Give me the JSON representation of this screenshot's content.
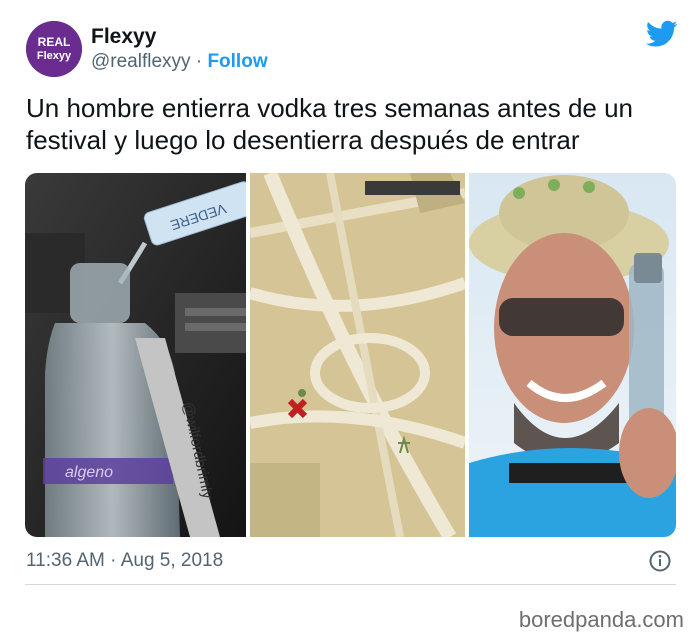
{
  "tweet": {
    "avatar_text_top": "REAL",
    "avatar_text_bottom": "Flexyy",
    "display_name": "Flexyy",
    "handle": "@realflexyy",
    "separator": " · ",
    "follow_label": "Follow",
    "body": "Un hombre entierra vodka tres semanas antes de un festival y luego lo desentierra después de entrar",
    "timestamp": "11:36 AM · Aug 5, 2018"
  },
  "media": {
    "panel1_bottle_label": "@wilfordbrimly",
    "panel1_brand": "algeno",
    "panel1_bottle_text": "VEDERE"
  },
  "icons": {
    "bird": "twitter-bird-icon",
    "info": "info-icon"
  },
  "colors": {
    "accent": "#1d9bf0",
    "muted": "#536471",
    "avatar_bg": "#6a2c8e"
  },
  "footer": {
    "credit": "boredpanda.com"
  }
}
